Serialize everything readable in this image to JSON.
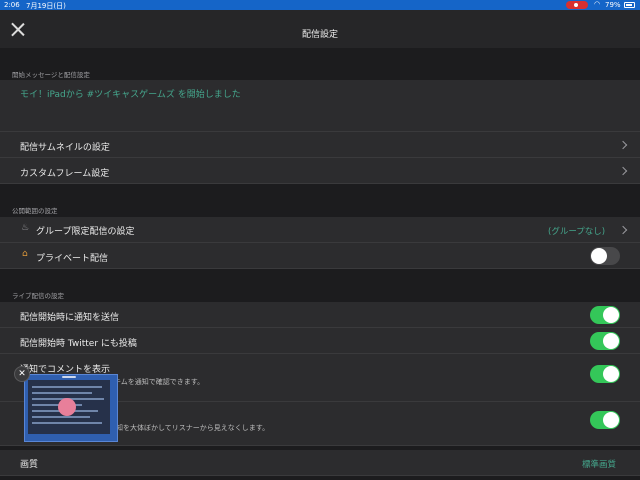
{
  "status": {
    "time": "2:06",
    "date": "7月19日(日)",
    "battery": "79%"
  },
  "nav": {
    "title": "配信設定"
  },
  "sections": {
    "start_message": "開始メッセージと配信設定",
    "visibility": "公開範囲の設定",
    "live": "ライブ配信の設定"
  },
  "start_message_text": "モイ！iPadから #ツイキャスゲームズ を開始しました",
  "rows": {
    "thumbnail": "配信サムネイルの設定",
    "custom_frame": "カスタムフレーム設定",
    "group_limited": "グループ限定配信の設定",
    "group_value": "(グループなし)",
    "private": "プライベート配信",
    "notify": "配信開始時に通知を送信",
    "twitter": "配信開始時 Twitter にも投稿",
    "comment_notify": "通知でコメントを表示",
    "comment_notify_sub": "テムを通知で確認できます。",
    "blur_sub": "知を大体ぼかしてリスナーから見えなくします。",
    "quality": "画質",
    "quality_value": "標準画質"
  },
  "toggles": {
    "private": false,
    "notify": true,
    "twitter": true,
    "comment_notify": true,
    "blur": true
  },
  "colors": {
    "accent": "#34c759",
    "link_text": "#45a78d",
    "statusbar": "#1565c8"
  }
}
